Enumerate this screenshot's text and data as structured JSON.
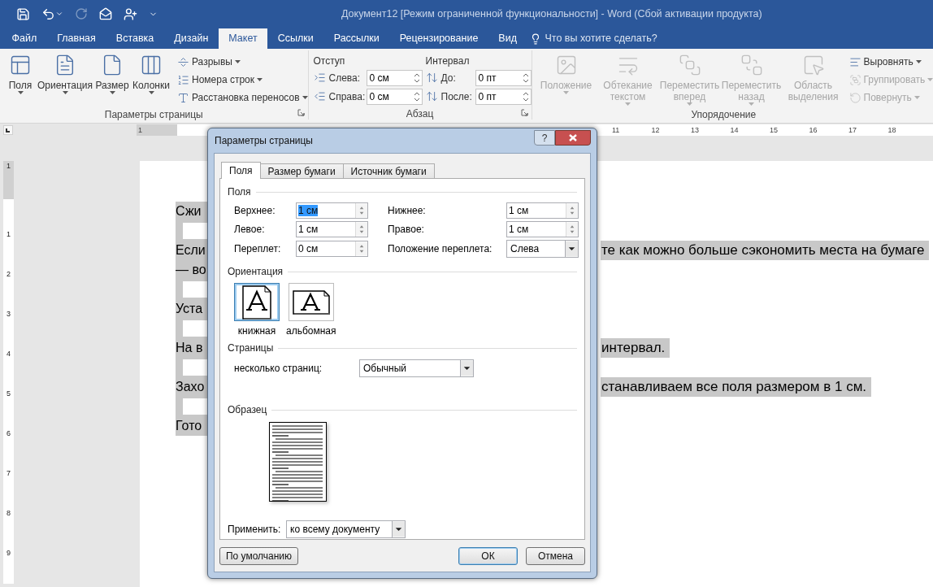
{
  "title_bar": {
    "title": "Документ12 [Режим ограниченной функциональности] - Word (Сбой активации продукта)"
  },
  "tabs": [
    {
      "label": "Файл",
      "selected": false
    },
    {
      "label": "Главная",
      "selected": false
    },
    {
      "label": "Вставка",
      "selected": false
    },
    {
      "label": "Дизайн",
      "selected": false
    },
    {
      "label": "Макет",
      "selected": true
    },
    {
      "label": "Ссылки",
      "selected": false
    },
    {
      "label": "Рассылки",
      "selected": false
    },
    {
      "label": "Рецензирование",
      "selected": false
    },
    {
      "label": "Вид",
      "selected": false
    }
  ],
  "tell_me": {
    "placeholder": "Что вы хотите сделать?"
  },
  "ribbon": {
    "groups": [
      {
        "kind": "page_setup",
        "title": "Параметры страницы",
        "large_buttons": [
          {
            "label": "Поля",
            "dropdown": true,
            "disabled": false
          },
          {
            "label": "Ориентация",
            "dropdown": true,
            "disabled": false
          },
          {
            "label": "Размер",
            "dropdown": true,
            "disabled": false
          },
          {
            "label": "Колонки",
            "dropdown": true,
            "disabled": false
          }
        ],
        "small_buttons": [
          {
            "label": "Разрывы",
            "disabled": false
          },
          {
            "label": "Номера строк",
            "disabled": false
          },
          {
            "label": "Расстановка переносов",
            "disabled": false
          }
        ]
      },
      {
        "kind": "paragraph",
        "title": "Абзац",
        "indent": {
          "heading": "Отступ",
          "fields": [
            {
              "label": "Слева:",
              "value": "0 см"
            },
            {
              "label": "Справа:",
              "value": "0 см"
            }
          ]
        },
        "spacing": {
          "heading": "Интервал",
          "fields": [
            {
              "label": "До:",
              "value": "0 пт"
            },
            {
              "label": "После:",
              "value": "0 пт"
            }
          ]
        }
      },
      {
        "kind": "arrange",
        "title": "Упорядочение",
        "large_buttons": [
          {
            "label": "Положение",
            "dropdown": true,
            "disabled": true
          },
          {
            "label": "Обтекание текстом",
            "dropdown": true,
            "disabled": true
          },
          {
            "label": "Переместить вперед",
            "dropdown": true,
            "disabled": true
          },
          {
            "label": "Переместить назад",
            "dropdown": true,
            "disabled": true
          },
          {
            "label": "Область выделения",
            "dropdown": false,
            "disabled": true
          }
        ],
        "small_buttons": [
          {
            "label": "Выровнять",
            "disabled": false
          },
          {
            "label": "Группировать",
            "disabled": true
          },
          {
            "label": "Повернуть",
            "disabled": true
          }
        ]
      }
    ]
  },
  "ruler": {
    "left_numbers": [
      "1"
    ],
    "right_numbers": [
      "11",
      "12",
      "13",
      "14",
      "15",
      "16",
      "17",
      "18"
    ],
    "vertical_numbers": [
      "1",
      "1",
      "2",
      "3",
      "4",
      "5",
      "6",
      "7",
      "8",
      "9"
    ]
  },
  "document": {
    "lines": [
      {
        "kind": "text",
        "left": "Сжи"
      },
      {
        "kind": "empty"
      },
      {
        "kind": "text",
        "left": "Если",
        "right": "те как можно больше сэкономить места на бумаге"
      },
      {
        "kind": "text",
        "left": "— во"
      },
      {
        "kind": "empty"
      },
      {
        "kind": "text",
        "left": "Уста"
      },
      {
        "kind": "empty"
      },
      {
        "kind": "text",
        "left": "На в",
        "right": "интервал."
      },
      {
        "kind": "empty"
      },
      {
        "kind": "text",
        "left": "Захо",
        "right": "станавливаем все поля размером в 1 см."
      },
      {
        "kind": "empty"
      },
      {
        "kind": "text",
        "left": "Гото"
      }
    ]
  },
  "dialog": {
    "title": "Параметры страницы",
    "help": "?",
    "tabs": [
      {
        "label": "Поля",
        "selected": true
      },
      {
        "label": "Размер бумаги",
        "selected": false
      },
      {
        "label": "Источник бумаги",
        "selected": false
      }
    ],
    "margins": {
      "heading": "Поля",
      "fields": [
        {
          "label": "Верхнее:",
          "value": "1 см",
          "selected": true
        },
        {
          "label": "Нижнее:",
          "value": "1 см",
          "selected": false
        },
        {
          "label": "Левое:",
          "value": "1 см",
          "selected": false
        },
        {
          "label": "Правое:",
          "value": "1 см",
          "selected": false
        },
        {
          "label": "Переплет:",
          "value": "0 см",
          "selected": false
        }
      ],
      "gutter_position": {
        "label": "Положение переплета:",
        "value": "Слева"
      }
    },
    "orientation": {
      "heading": "Ориентация",
      "options": [
        {
          "label": "книжная",
          "selected": true
        },
        {
          "label": "альбомная",
          "selected": false
        }
      ]
    },
    "pages": {
      "heading": "Страницы",
      "label": "несколько страниц:",
      "value": "Обычный"
    },
    "preview": {
      "heading": "Образец"
    },
    "apply_to": {
      "label": "Применить:",
      "value": "ко всему документу"
    },
    "buttons": [
      {
        "label": "По умолчанию",
        "default": false
      },
      {
        "label": "ОК",
        "default": true
      },
      {
        "label": "Отмена",
        "default": false
      }
    ]
  }
}
